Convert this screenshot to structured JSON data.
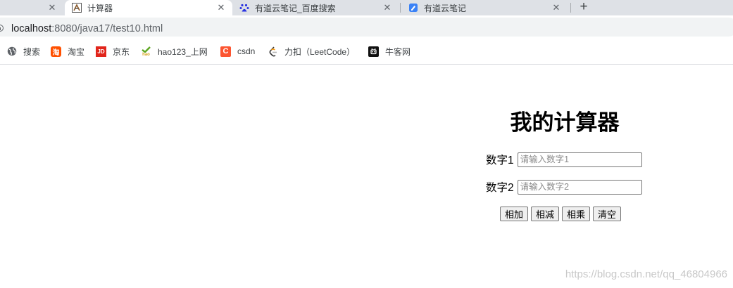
{
  "tabs": [
    {
      "title": "",
      "active": false,
      "close": "✕"
    },
    {
      "title": "计算器",
      "active": true,
      "close": "✕"
    },
    {
      "title": "有道云笔记_百度搜索",
      "active": false,
      "close": "✕"
    },
    {
      "title": "有道云笔记",
      "active": false,
      "close": "✕"
    }
  ],
  "new_tab_label": "+",
  "address": {
    "host": "localhost",
    "path": ":8080/java17/test10.html"
  },
  "bookmarks": [
    {
      "label": "搜索",
      "icon": "globe-icon"
    },
    {
      "label": "淘宝",
      "icon": "taobao-icon"
    },
    {
      "label": "京东",
      "icon": "jd-icon"
    },
    {
      "label": "hao123_上网",
      "icon": "hao123-icon"
    },
    {
      "label": "csdn",
      "icon": "csdn-icon"
    },
    {
      "label": "力扣（LeetCode）",
      "icon": "leetcode-icon"
    },
    {
      "label": "牛客网",
      "icon": "nowcoder-icon"
    }
  ],
  "bookmark_icon_text": {
    "taobao": "淘",
    "jd": "JD",
    "csdn": "C",
    "hao": "hao"
  },
  "page": {
    "title": "我的计算器",
    "num1_label": "数字1",
    "num1_placeholder": "请输入数字1",
    "num2_label": "数字2",
    "num2_placeholder": "请输入数字2",
    "buttons": {
      "add": "相加",
      "subtract": "相减",
      "multiply": "相乘",
      "clear": "清空"
    }
  },
  "watermark": "https://blog.csdn.net/qq_46804966",
  "colors": {
    "tabstrip_bg": "#dee1e6",
    "omnibox_bg": "#f1f3f4",
    "taobao_orange": "#ff5000",
    "jd_red": "#e1251b",
    "csdn_red": "#fc5531",
    "hao_green": "#5aa51e",
    "baidu_blue": "#2932e1",
    "youdao_blue": "#3b82f6"
  }
}
